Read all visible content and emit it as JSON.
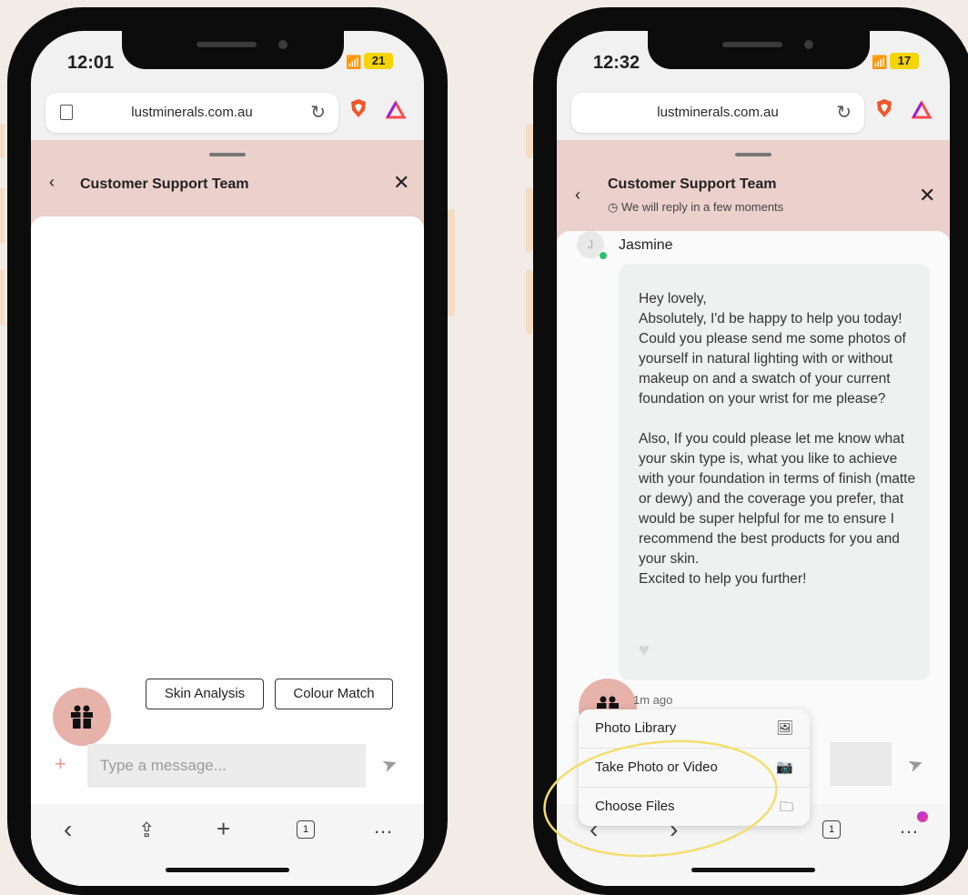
{
  "left_phone": {
    "status": {
      "time": "12:01",
      "battery": "21"
    },
    "browser": {
      "url": "lustminerals.com.au"
    },
    "chat_header": {
      "title": "Customer Support Team"
    },
    "quick_replies": [
      "Skin Analysis",
      "Colour Match"
    ],
    "composer": {
      "placeholder": "Type a message..."
    },
    "toolbar": {
      "tab_count": "1"
    }
  },
  "right_phone": {
    "status": {
      "time": "12:32",
      "battery": "17"
    },
    "browser": {
      "url": "lustminerals.com.au"
    },
    "chat_header": {
      "title": "Customer Support Team",
      "subtitle": "We will reply in a few moments"
    },
    "agent": {
      "initial": "J",
      "name": "Jasmine"
    },
    "message": {
      "lines": [
        "Hey lovely,",
        "Absolutely, I'd be happy to help you today!",
        "Could you please send me some photos of yourself in natural lighting with or without makeup on and a swatch of your current foundation on your wrist for me please?",
        "",
        "Also, If you could please let me know what your skin type is, what you like to achieve with your foundation in terms of finish (matte or dewy) and the coverage you prefer, that would be super helpful for me to ensure I recommend the best products for you and your skin.",
        "Excited to help you further!"
      ],
      "time_ago": "1m ago"
    },
    "attach_menu": [
      {
        "label": "Photo Library",
        "icon": "photo-library-icon"
      },
      {
        "label": "Take Photo or Video",
        "icon": "camera-icon"
      },
      {
        "label": "Choose Files",
        "icon": "folder-icon"
      }
    ],
    "toolbar": {
      "tab_count": "1"
    }
  },
  "colors": {
    "background": "#f3ece6",
    "header_pink": "#ecd0cb",
    "gift_button": "#e6b2a9",
    "highlight_circle": "#f3de6e"
  }
}
